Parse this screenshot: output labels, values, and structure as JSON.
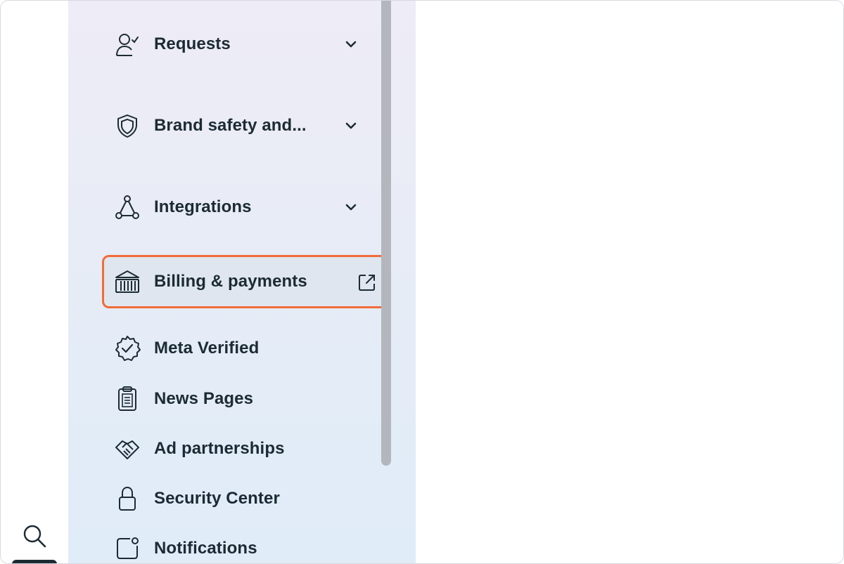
{
  "sidebar": {
    "items": [
      {
        "label": "Requests",
        "icon": "person-check-icon",
        "has_chevron": true
      },
      {
        "label": "Brand safety and...",
        "icon": "shield-icon",
        "has_chevron": true
      },
      {
        "label": "Integrations",
        "icon": "network-icon",
        "has_chevron": true
      },
      {
        "label": "Billing & payments",
        "icon": "bank-icon",
        "has_external_link": true,
        "selected": true
      },
      {
        "label": "Meta Verified",
        "icon": "verified-badge-icon"
      },
      {
        "label": "News Pages",
        "icon": "clipboard-icon"
      },
      {
        "label": "Ad partnerships",
        "icon": "handshake-icon"
      },
      {
        "label": "Security Center",
        "icon": "lock-icon"
      },
      {
        "label": "Notifications",
        "icon": "notification-square-icon"
      }
    ]
  },
  "rail": {
    "search_icon": "search-icon"
  },
  "colors": {
    "text": "#1c2b33",
    "highlight_border": "#f26b3a",
    "sidebar_bg_top": "#eeecf6",
    "sidebar_bg_bottom": "#e0ecf8",
    "scrollbar": "#b3b7bd"
  }
}
